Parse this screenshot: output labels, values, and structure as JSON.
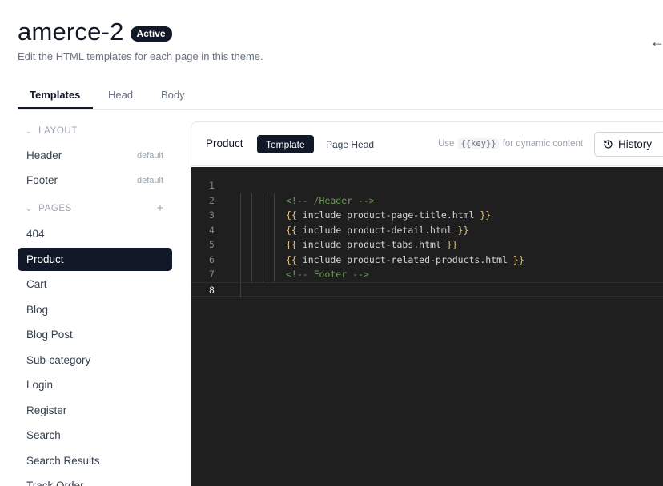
{
  "header": {
    "title": "amerce-2",
    "status": "Active",
    "subtitle": "Edit the HTML templates for each page in this theme."
  },
  "tabs": [
    {
      "label": "Templates",
      "active": true
    },
    {
      "label": "Head",
      "active": false
    },
    {
      "label": "Body",
      "active": false
    }
  ],
  "sidebar": {
    "layout_section": "LAYOUT",
    "layout_items": [
      {
        "label": "Header",
        "tag": "default"
      },
      {
        "label": "Footer",
        "tag": "default"
      }
    ],
    "pages_section": "PAGES",
    "page_items": [
      {
        "label": "404"
      },
      {
        "label": "Product",
        "active": true
      },
      {
        "label": "Cart"
      },
      {
        "label": "Blog"
      },
      {
        "label": "Blog Post"
      },
      {
        "label": "Sub-category"
      },
      {
        "label": "Login"
      },
      {
        "label": "Register"
      },
      {
        "label": "Search"
      },
      {
        "label": "Search Results"
      },
      {
        "label": "Track Order"
      }
    ]
  },
  "editor_panel": {
    "title": "Product",
    "segments": [
      {
        "label": "Template",
        "active": true
      },
      {
        "label": "Page Head",
        "active": false
      }
    ],
    "hint_prefix": "Use",
    "hint_code": "{{key}}",
    "hint_suffix": "for dynamic content",
    "history_label": "History"
  },
  "code": {
    "current_line": 8,
    "lines": [
      {
        "n": "1",
        "text": ""
      },
      {
        "n": "2",
        "text": "<!-- /Header -->",
        "kind": "comment"
      },
      {
        "n": "3",
        "open": "{{",
        "body": " include product-page-title.html ",
        "close": "}}"
      },
      {
        "n": "4",
        "open": "{{",
        "body": " include product-detail.html ",
        "close": "}}"
      },
      {
        "n": "5",
        "open": "{{",
        "body": " include product-tabs.html ",
        "close": "}}"
      },
      {
        "n": "6",
        "open": "{{",
        "body": " include product-related-products.html ",
        "close": "}}"
      },
      {
        "n": "7",
        "text": "<!-- Footer -->",
        "kind": "comment"
      },
      {
        "n": "8",
        "text": ""
      }
    ]
  },
  "colors": {
    "accent": "#111827",
    "editor_bg": "#1f1f1f",
    "comment": "#6a9955",
    "brace": "#e5c07b"
  }
}
